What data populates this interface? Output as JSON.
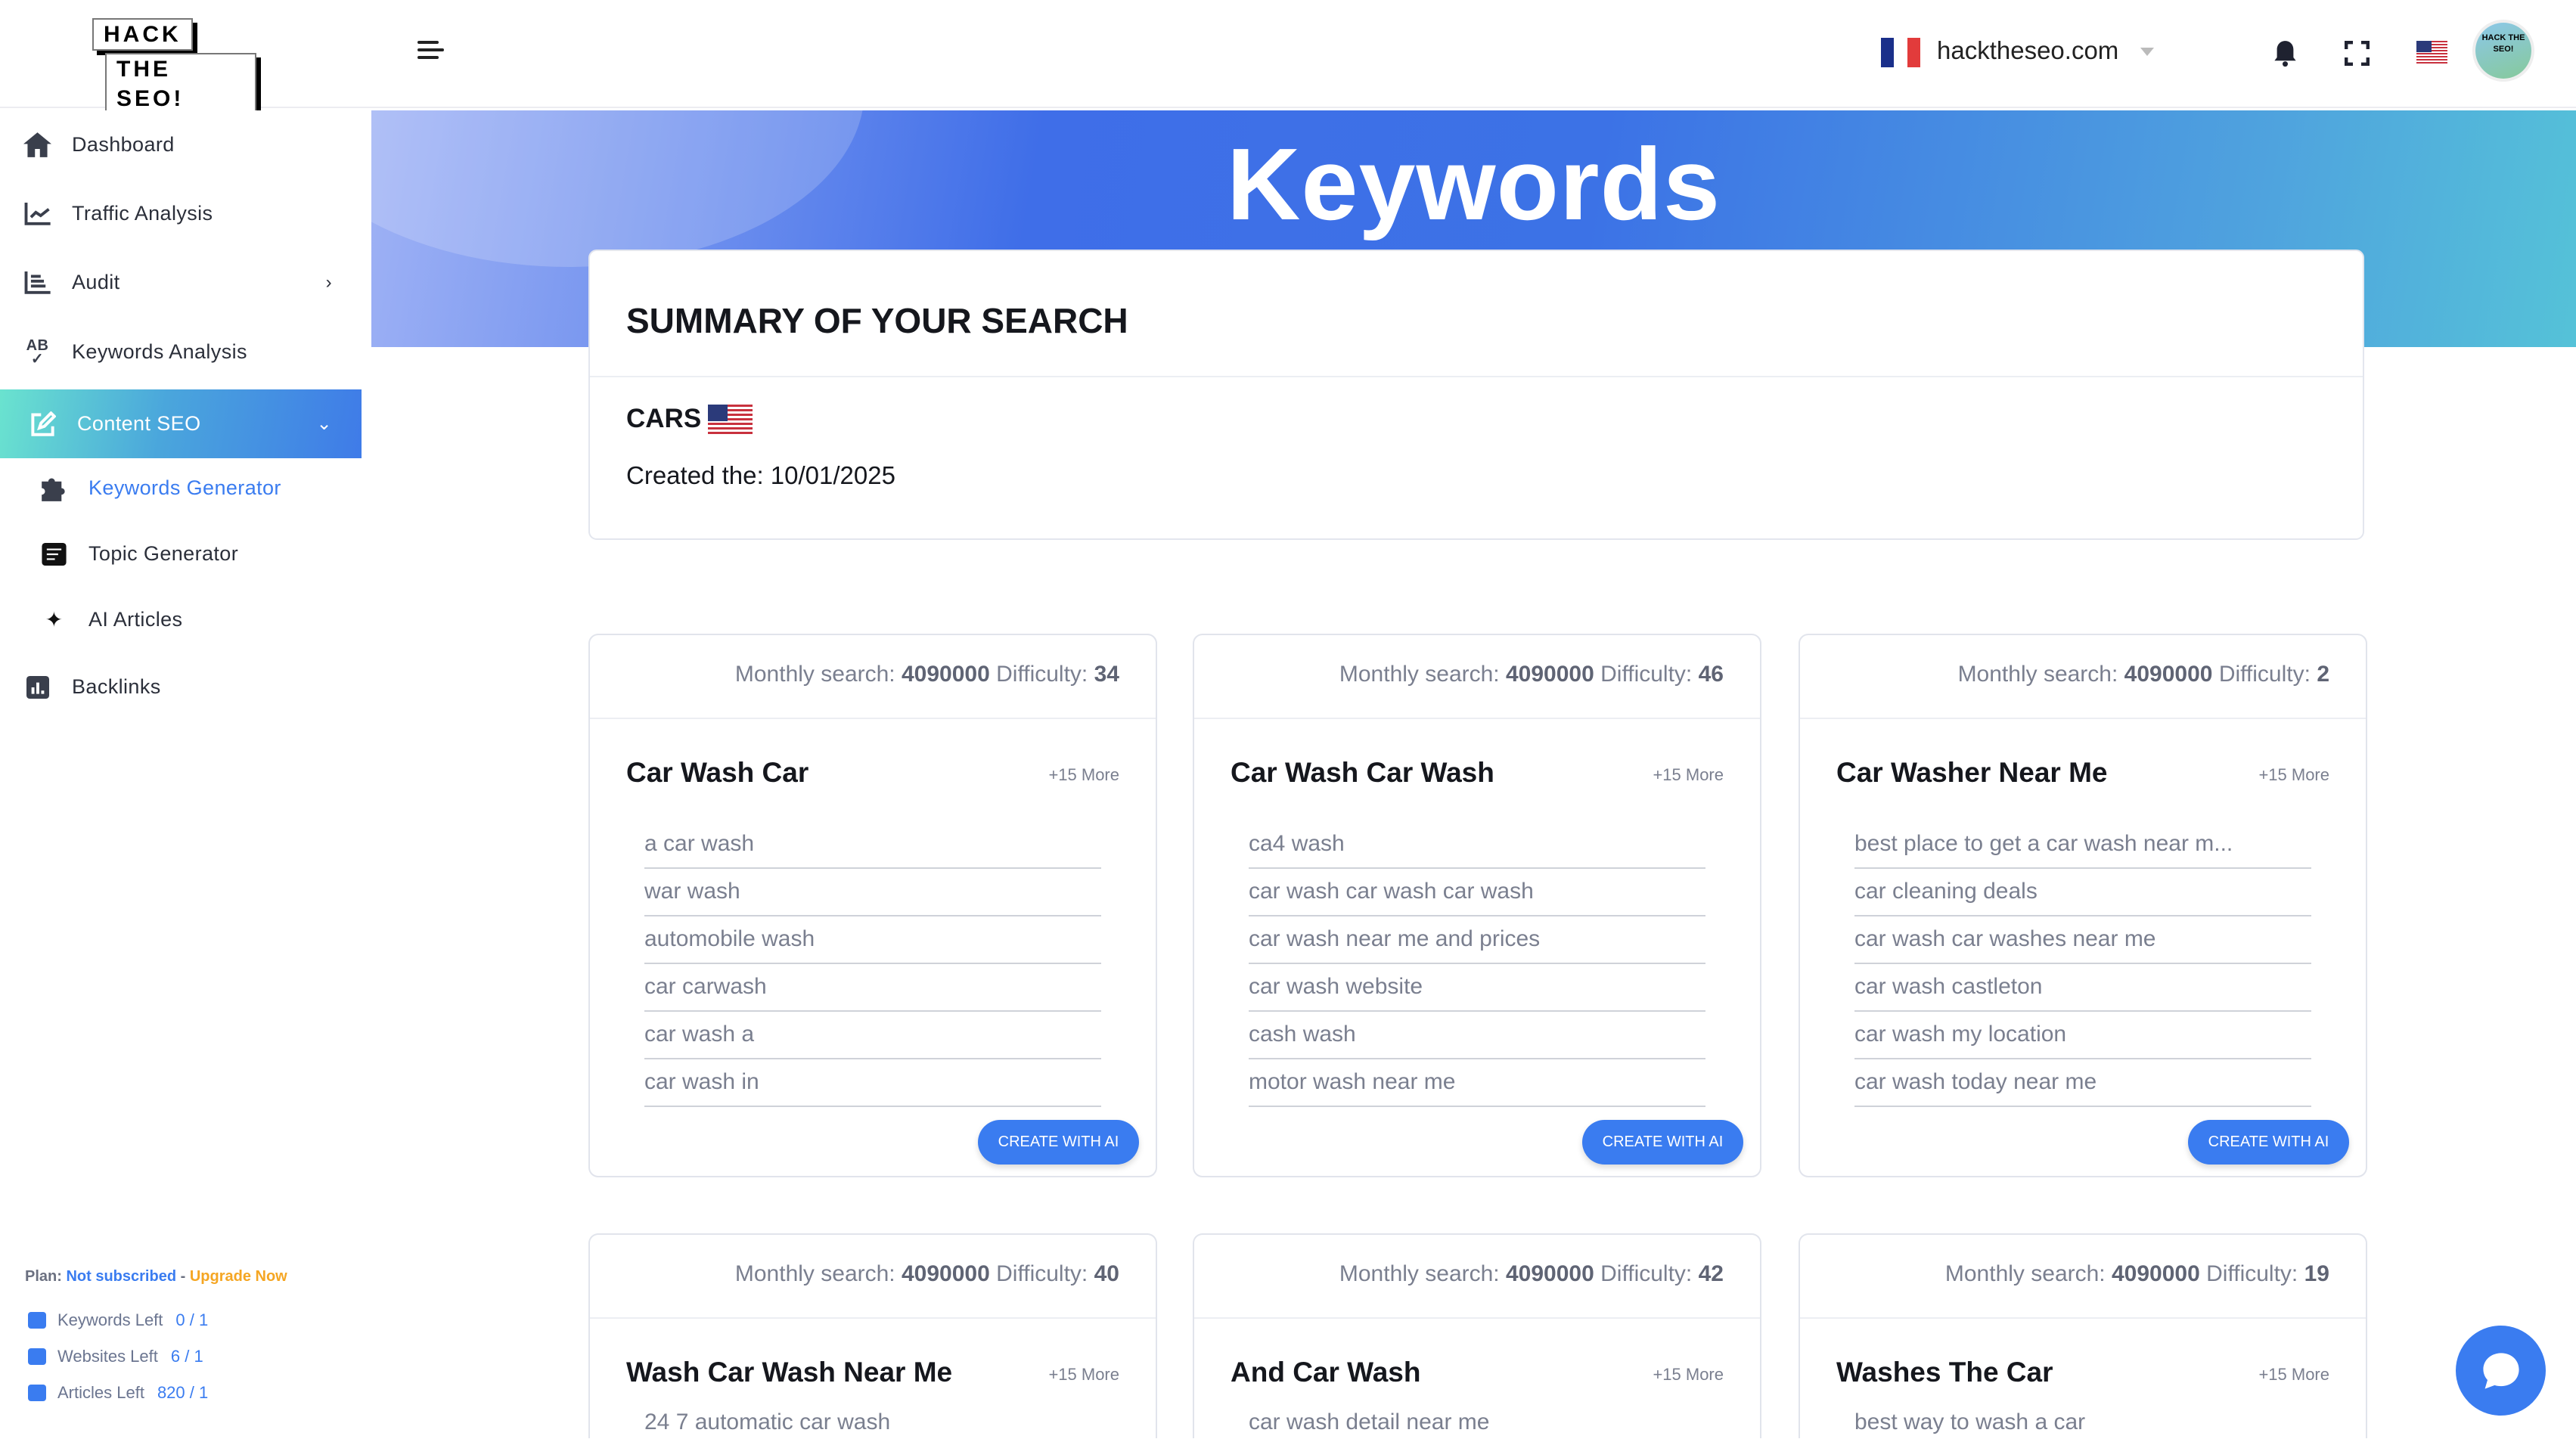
{
  "header": {
    "logo_text": [
      "HACK",
      "THE SEO!"
    ],
    "domain": "hacktheseo.com",
    "avatar_text": "HACK THE SEO!",
    "flag_colors": [
      "#1a2f8a",
      "#ffffff",
      "#e23b3b"
    ]
  },
  "sidebar": {
    "items": [
      {
        "label": "Dashboard",
        "icon": "home-icon"
      },
      {
        "label": "Traffic Analysis",
        "icon": "line-chart-icon"
      },
      {
        "label": "Audit",
        "icon": "list-chart-icon"
      },
      {
        "label": "Keywords Analysis",
        "icon": "spellcheck-icon"
      },
      {
        "label": "Content SEO",
        "icon": "edit-icon"
      },
      {
        "label": "Keywords Generator",
        "icon": "puzzle-icon"
      },
      {
        "label": "Topic Generator",
        "icon": "notepad-icon"
      },
      {
        "label": "AI Articles",
        "icon": "sparkles-icon"
      },
      {
        "label": "Backlinks",
        "icon": "bar-chart-icon"
      }
    ],
    "plan": {
      "label": "Plan:",
      "status": "Not subscribed",
      "sep": "-",
      "upgrade": "Upgrade Now"
    },
    "quotas": [
      {
        "label": "Keywords Left",
        "value": "0 / 1"
      },
      {
        "label": "Websites Left",
        "value": "6 / 1"
      },
      {
        "label": "Articles Left",
        "value": "820 / 1"
      }
    ]
  },
  "colors": {
    "accent": "#3a7cf0",
    "upgrade": "#f5a623"
  },
  "banner": {
    "title": "Keywords"
  },
  "summary": {
    "heading": "SUMMARY OF YOUR SEARCH",
    "name": "CARS",
    "created": "Created the: 10/01/2025"
  },
  "card_labels": {
    "monthly": "Monthly search:",
    "difficulty": "Difficulty:",
    "button": "CREATE WITH AI"
  },
  "cards": [
    {
      "monthly": "4090000",
      "difficulty": "34",
      "title": "Car Wash Car",
      "more": "+15 More",
      "keywords": [
        "a car wash",
        "war wash",
        "automobile wash",
        "car carwash",
        "car wash a",
        "car wash in"
      ]
    },
    {
      "monthly": "4090000",
      "difficulty": "46",
      "title": "Car Wash Car Wash",
      "more": "+15 More",
      "keywords": [
        "ca4 wash",
        "car wash car wash car wash",
        "car wash near me and prices",
        "car wash website",
        "cash wash",
        "motor wash near me"
      ]
    },
    {
      "monthly": "4090000",
      "difficulty": "2",
      "title": "Car Washer Near Me",
      "more": "+15 More",
      "keywords": [
        "best place to get a car wash near m...",
        "car cleaning deals",
        "car wash car washes near me",
        "car wash castleton",
        "car wash my location",
        "car wash today near me"
      ]
    },
    {
      "monthly": "4090000",
      "difficulty": "40",
      "title": "Wash Car Wash Near Me",
      "more": "+15 More",
      "keywords": [
        "24 7 automatic car wash"
      ]
    },
    {
      "monthly": "4090000",
      "difficulty": "42",
      "title": "And Car Wash",
      "more": "+15 More",
      "keywords": [
        "car wash detail near me"
      ]
    },
    {
      "monthly": "4090000",
      "difficulty": "19",
      "title": "Washes The Car",
      "more": "+15 More",
      "keywords": [
        "best way to wash a car"
      ]
    }
  ]
}
